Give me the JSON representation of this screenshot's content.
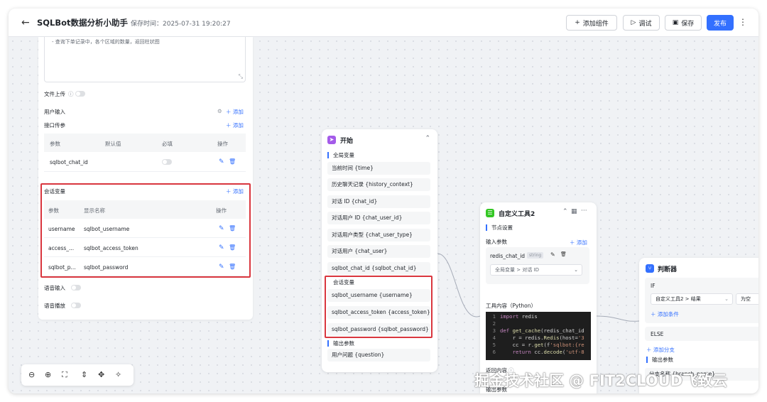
{
  "header": {
    "back_icon": "arrow-left-icon",
    "title": "SQLBot数据分析小助手",
    "save_time": "保存时间：2025-07-31 19:20:27",
    "buttons": {
      "add_component": "添加组件",
      "debug": "调试",
      "save": "保存",
      "publish": "发布"
    },
    "more_icon": "more-vertical-icon"
  },
  "left_panel": {
    "prompt_lines": [
      "- 查询下单记录中，各个区域的数量，返回柱状图"
    ],
    "file_upload": "文件上传",
    "user_input": "用户输入",
    "user_input_add": "添加",
    "api_params": "接口传参",
    "api_params_add": "添加",
    "api_table": {
      "headers": [
        "参数",
        "默认值",
        "必填",
        "操作"
      ],
      "rows": [
        {
          "param": "sqlbot_chat_id",
          "default": "",
          "required": false
        }
      ]
    },
    "session_vars": "会话变量",
    "session_vars_add": "添加",
    "session_table": {
      "headers": [
        "参数",
        "显示名称",
        "操作"
      ],
      "rows": [
        {
          "param": "username",
          "display": "sqlbot_username"
        },
        {
          "param": "access_...",
          "display": "sqlbot_access_token"
        },
        {
          "param": "sqlbot_p...",
          "display": "sqlbot_password"
        }
      ]
    },
    "voice_input": "语音输入",
    "voice_play": "语音播放"
  },
  "zoom_toolbar": {
    "icons": [
      "zoom-out-icon",
      "zoom-in-icon",
      "fit-view-icon",
      "collapse-icon",
      "expand-icon",
      "cleanup-icon"
    ]
  },
  "start_node": {
    "title": "开始",
    "global_vars_head": "全局变量",
    "global_vars": [
      "当前时间 {time}",
      "历史聊天记录 {history_context}",
      "对话 ID {chat_id}",
      "对话用户 ID {chat_user_id}",
      "对话用户类型 {chat_user_type}",
      "对话用户 {chat_user}",
      "sqlbot_chat_id {sqlbot_chat_id}"
    ],
    "session_vars_head": "会话变量",
    "session_vars": [
      "sqlbot_username {username}",
      "sqlbot_access_token {access_token}",
      "sqlbot_password {sqlbot_password}"
    ],
    "output_head": "输出参数",
    "output": [
      "用户问题 {question}"
    ]
  },
  "tool_node": {
    "title": "自定义工具2",
    "node_settings": "节点设置",
    "input_params": "输入参数",
    "add": "添加",
    "param_name": "redis_chat_id",
    "param_type": "string",
    "param_value": "全局变量 > 对话 ID",
    "tool_content": "工具内容（Python）",
    "code": [
      {
        "n": "1",
        "text": "import redis"
      },
      {
        "n": "2",
        "text": ""
      },
      {
        "n": "3",
        "text": "def get_cache(redis_chat_id"
      },
      {
        "n": "4",
        "text": "    r = redis.Redis(host='3"
      },
      {
        "n": "5",
        "text": "    cc = r.get(f'sqlbot:{re"
      },
      {
        "n": "6",
        "text": "    return cc.decode('utf-8"
      }
    ],
    "return_content": "返回内容",
    "output_params": "输出参数"
  },
  "judge_node": {
    "title": "判断器",
    "if_label": "IF",
    "condition_field": "自定义工具2 > 结果",
    "condition_op": "为空",
    "add_condition": "添加条件",
    "else_label": "ELSE",
    "add_branch": "添加分支",
    "output_head": "输出参数",
    "branch_name": "分支名称 {branch_name}"
  },
  "watermark": "掘金技术社区 @ FIT2CLOUD飞致云",
  "colors": {
    "primary": "#3370ff",
    "highlight_border": "#d9363e",
    "start_icon": "#a45be9",
    "tool_icon": "#34c724",
    "judge_icon": "#3370ff"
  }
}
